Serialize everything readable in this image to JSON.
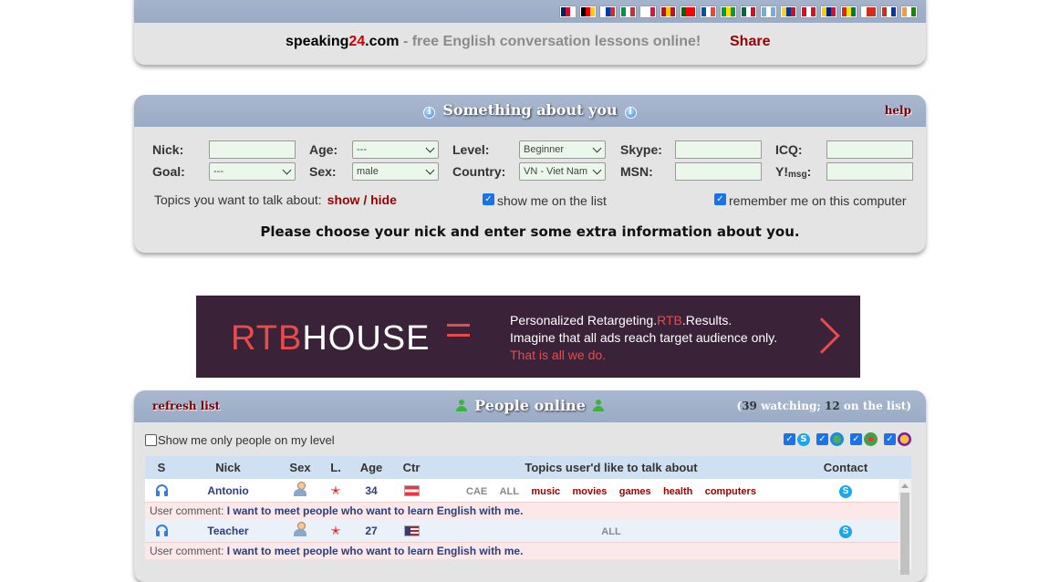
{
  "top": {
    "flags": [
      {
        "name": "flag-uk",
        "c": [
          "#012169",
          "#c8102e",
          "#ffffff"
        ]
      },
      {
        "name": "flag-de",
        "c": [
          "#000000",
          "#dd0000",
          "#ffce00"
        ]
      },
      {
        "name": "flag-ru",
        "c": [
          "#ffffff",
          "#0039a6",
          "#d52b1e"
        ]
      },
      {
        "name": "flag-it",
        "c": [
          "#009246",
          "#ffffff",
          "#ce2b37"
        ]
      },
      {
        "name": "flag-pl",
        "c": [
          "#ffffff",
          "#ffffff",
          "#dc143c"
        ]
      },
      {
        "name": "flag-es",
        "c": [
          "#c60b1e",
          "#ffc400",
          "#c60b1e"
        ]
      },
      {
        "name": "flag-pt",
        "c": [
          "#006600",
          "#ff0000",
          "#ff0000"
        ]
      },
      {
        "name": "flag-fr",
        "c": [
          "#0055a4",
          "#ffffff",
          "#ef4135"
        ]
      },
      {
        "name": "flag-br",
        "c": [
          "#009c3b",
          "#ffdf00",
          "#009c3b"
        ]
      },
      {
        "name": "flag-mx",
        "c": [
          "#006847",
          "#ffffff",
          "#ce1126"
        ]
      },
      {
        "name": "flag-ar",
        "c": [
          "#74acdf",
          "#ffffff",
          "#74acdf"
        ]
      },
      {
        "name": "flag-co",
        "c": [
          "#fcd116",
          "#003893",
          "#ce1126"
        ]
      },
      {
        "name": "flag-pe",
        "c": [
          "#d91023",
          "#ffffff",
          "#d91023"
        ]
      },
      {
        "name": "flag-ve",
        "c": [
          "#ffcc00",
          "#00247d",
          "#cf142b"
        ]
      },
      {
        "name": "flag-bo",
        "c": [
          "#d52b1e",
          "#f9e300",
          "#007934"
        ]
      },
      {
        "name": "flag-cl",
        "c": [
          "#ffffff",
          "#d52b1e",
          "#d52b1e"
        ]
      },
      {
        "name": "flag-py",
        "c": [
          "#d52b1e",
          "#ffffff",
          "#0038a8"
        ]
      },
      {
        "name": "flag-in",
        "c": [
          "#ff9933",
          "#ffffff",
          "#138808"
        ]
      }
    ],
    "site_prefix": "speaking",
    "site_number": "24",
    "site_suffix": ".com",
    "tagline": " - free English conversation lessons online!",
    "share": "Share"
  },
  "about": {
    "title": "Something about you",
    "help": "help",
    "labels": {
      "nick": "Nick:",
      "age": "Age:",
      "level": "Level:",
      "skype": "Skype:",
      "icq": "ICQ:",
      "goal": "Goal:",
      "sex": "Sex:",
      "country": "Country:",
      "msn": "MSN:",
      "ymsg_main": "Y!",
      "ymsg_sub": "msg",
      "ymsg_colon": ":"
    },
    "values": {
      "age": "---",
      "level": "Beginner",
      "goal": "---",
      "sex": "male",
      "country": "VN - Viet Nam"
    },
    "topics_label": "Topics you want to talk about:",
    "topics_link": "show / hide",
    "show_on_list": "show me on the list",
    "remember": "remember me on this computer",
    "instruction": "Please choose your nick and enter some extra information about you."
  },
  "ad": {
    "logo_rtb": "RTB",
    "logo_house": "HOUSE",
    "line1_a": "Personalized Retargeting.",
    "line1_b": "RTB",
    "line1_c": ".Results.",
    "line2": "Imagine that all ads reach target audience only.",
    "line3": "That is all we do."
  },
  "people": {
    "refresh": "refresh list",
    "title": "People online",
    "watching_open": "(",
    "watching_count": "39",
    "watching_text": " watching; ",
    "on_list_count": "12",
    "on_list_text": " on the list)",
    "level_filter": "Show me only people on my level",
    "columns": {
      "s": "S",
      "nick": "Nick",
      "sex": "Sex",
      "l": "L.",
      "age": "Age",
      "ctr": "Ctr",
      "topics": "Topics user'd like to talk about",
      "contact": "Contact"
    },
    "comment_label": "User comment:",
    "rows": [
      {
        "nick": "Antonio",
        "age": "34",
        "levels": [
          "CAE",
          "ALL"
        ],
        "topics": [
          "music",
          "movies",
          "games",
          "health",
          "computers"
        ],
        "comment": "I want to meet people who want to learn English with me."
      },
      {
        "nick": "Teacher",
        "age": "27",
        "levels": [
          "ALL"
        ],
        "topics": [],
        "comment": "I want to meet people who want to learn English with me."
      }
    ]
  }
}
